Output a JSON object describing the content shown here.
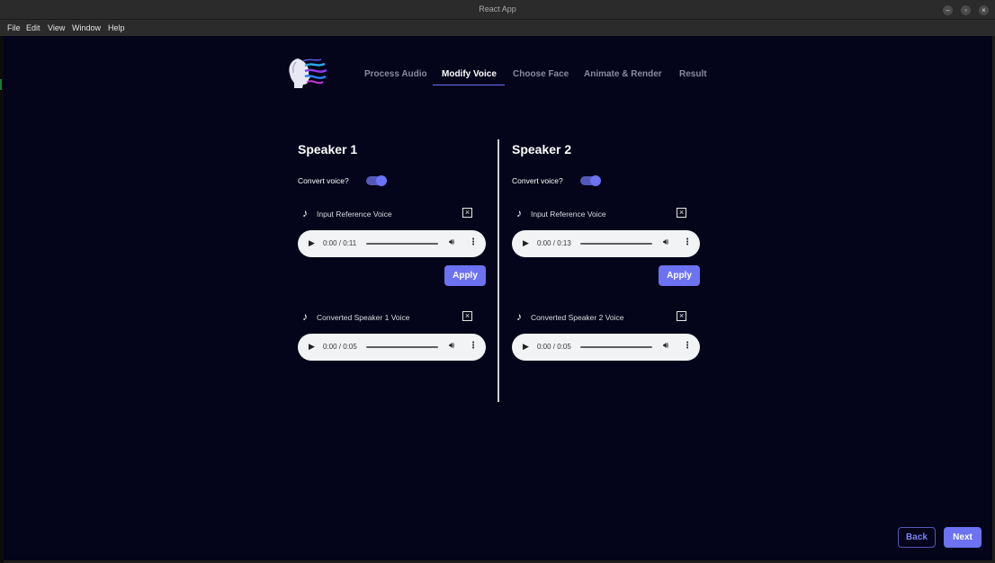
{
  "window": {
    "title": "React App",
    "controls": [
      "–",
      "▫",
      "×"
    ]
  },
  "menu": [
    "File",
    "Edit",
    "View",
    "Window",
    "Help"
  ],
  "nav": {
    "tabs": [
      "Process Audio",
      "Modify Voice",
      "Choose Face",
      "Animate & Render",
      "Result"
    ],
    "active_tab": "Modify Voice"
  },
  "speakers": [
    {
      "title": "Speaker 1",
      "convert_label": "Convert voice?",
      "convert_enabled": true,
      "reference": {
        "label": "Input Reference Voice",
        "time": "0:00 / 0:11"
      },
      "apply_label": "Apply",
      "converted": {
        "label": "Converted Speaker 1 Voice",
        "time": "0:00 / 0:05"
      }
    },
    {
      "title": "Speaker 2",
      "convert_label": "Convert voice?",
      "convert_enabled": true,
      "reference": {
        "label": "Input Reference Voice",
        "time": "0:00 / 0:13"
      },
      "apply_label": "Apply",
      "converted": {
        "label": "Converted Speaker 2 Voice",
        "time": "0:00 / 0:05"
      }
    }
  ],
  "footer": {
    "back_label": "Back",
    "next_label": "Next"
  },
  "colors": {
    "background": "#04041a",
    "accent": "#6c72f2",
    "divider": "#cfcfd4"
  },
  "icons": {
    "file": "music-note-icon",
    "remove": "close-box-icon",
    "play": "play-icon",
    "volume": "volume-icon",
    "more": "more-vertical-icon"
  }
}
